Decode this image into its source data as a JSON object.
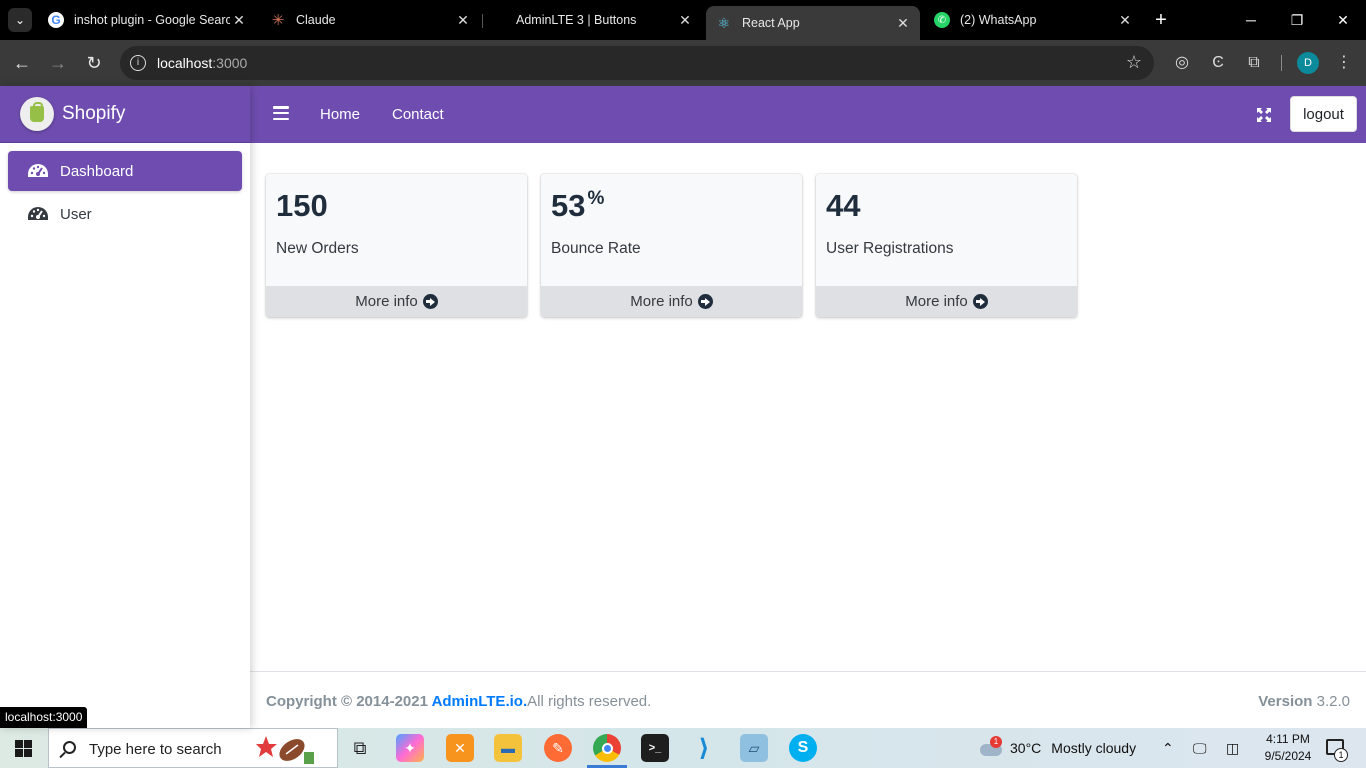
{
  "browser": {
    "tabs": [
      {
        "title": "inshot plugin - Google Search",
        "icon": "google-icon"
      },
      {
        "title": "Claude",
        "icon": "claude-icon"
      },
      {
        "title": "AdminLTE 3 | Buttons",
        "icon": "none"
      },
      {
        "title": "React App",
        "icon": "react-icon",
        "active": true
      },
      {
        "title": "(2) WhatsApp",
        "icon": "whatsapp-icon"
      }
    ],
    "url_host": "localhost",
    "url_port": ":3000",
    "profile_initial": "D",
    "status_link": "localhost:3000"
  },
  "app": {
    "brand": "Shopify",
    "sidebar": {
      "items": [
        {
          "label": "Dashboard",
          "icon": "gauge-icon",
          "active": true
        },
        {
          "label": "User",
          "icon": "gauge-icon",
          "active": false
        }
      ]
    },
    "header": {
      "nav": [
        {
          "label": "Home"
        },
        {
          "label": "Contact"
        }
      ],
      "logout_label": "logout"
    },
    "boxes": [
      {
        "value": "150",
        "suffix": "",
        "label": "New Orders",
        "footer": "More info"
      },
      {
        "value": "53",
        "suffix": "%",
        "label": "Bounce Rate",
        "footer": "More info"
      },
      {
        "value": "44",
        "suffix": "",
        "label": "User Registrations",
        "footer": "More info"
      }
    ],
    "footer": {
      "copyright_prefix": "Copyright © 2014-2021 ",
      "copyright_link": "AdminLTE.io.",
      "copyright_suffix": "All rights reserved.",
      "version_label": "Version",
      "version_value": "3.2.0"
    }
  },
  "taskbar": {
    "search_placeholder": "Type here to search",
    "weather_temp": "30°C",
    "weather_desc": "Mostly cloudy",
    "weather_badge": "1",
    "time": "4:11 PM",
    "date": "9/5/2024",
    "notification_count": "1"
  },
  "colors": {
    "brand_purple": "#6f4db0",
    "box_bg": "#f8f9fa",
    "link_blue": "#007bff"
  }
}
